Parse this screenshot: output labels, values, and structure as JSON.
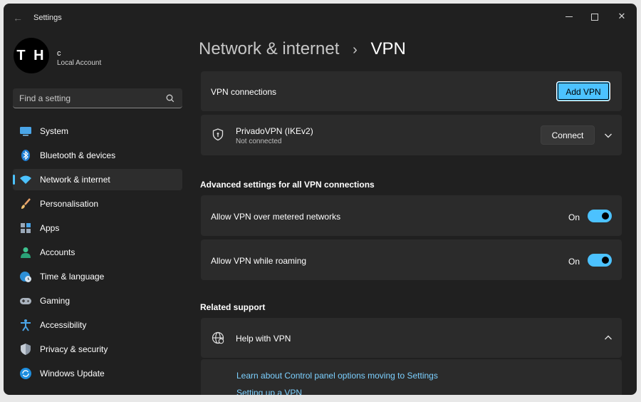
{
  "window": {
    "title": "Settings",
    "controls": {
      "minimize": "minimize-icon",
      "maximize": "maximize-icon",
      "close": "✕"
    }
  },
  "profile": {
    "initials": "T H",
    "name": "c",
    "account_type": "Local Account"
  },
  "search": {
    "placeholder": "Find a setting",
    "value": ""
  },
  "sidebar": {
    "items": [
      {
        "label": "System",
        "icon": "system-icon",
        "active": false
      },
      {
        "label": "Bluetooth & devices",
        "icon": "bluetooth-icon",
        "active": false
      },
      {
        "label": "Network & internet",
        "icon": "wifi-icon",
        "active": true
      },
      {
        "label": "Personalisation",
        "icon": "brush-icon",
        "active": false
      },
      {
        "label": "Apps",
        "icon": "apps-icon",
        "active": false
      },
      {
        "label": "Accounts",
        "icon": "person-icon",
        "active": false
      },
      {
        "label": "Time & language",
        "icon": "globe-clock-icon",
        "active": false
      },
      {
        "label": "Gaming",
        "icon": "gamepad-icon",
        "active": false
      },
      {
        "label": "Accessibility",
        "icon": "accessibility-icon",
        "active": false
      },
      {
        "label": "Privacy & security",
        "icon": "shield-icon",
        "active": false
      },
      {
        "label": "Windows Update",
        "icon": "update-icon",
        "active": false
      }
    ]
  },
  "breadcrumb": {
    "parent": "Network & internet",
    "separator": "›",
    "current": "VPN"
  },
  "vpn_connections": {
    "label": "VPN connections",
    "add_button": "Add VPN"
  },
  "vpn_entry": {
    "name": "PrivadoVPN (IKEv2)",
    "status": "Not connected",
    "connect_button": "Connect"
  },
  "advanced": {
    "title": "Advanced settings for all VPN connections",
    "settings": [
      {
        "label": "Allow VPN over metered networks",
        "state": "On",
        "on": true
      },
      {
        "label": "Allow VPN while roaming",
        "state": "On",
        "on": true
      }
    ]
  },
  "related": {
    "title": "Related support",
    "help_title": "Help with VPN",
    "links": [
      "Learn about Control panel options moving to Settings",
      "Setting up a VPN"
    ]
  },
  "colors": {
    "accent": "#4cc2ff",
    "background": "#202020",
    "card": "#2b2b2b"
  }
}
